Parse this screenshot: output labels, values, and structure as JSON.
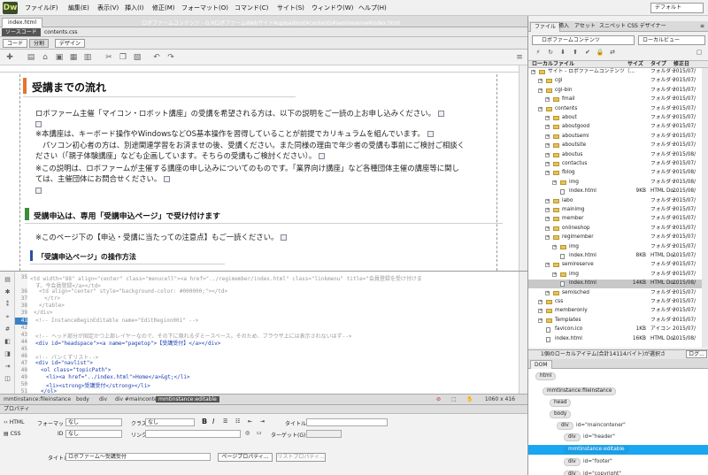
{
  "menubar": {
    "logo": "Dw",
    "items": [
      "ファイル(F)",
      "編集(E)",
      "表示(V)",
      "挿入(I)",
      "修正(M)",
      "フォーマット(O)",
      "コマンド(C)",
      "サイト(S)",
      "ウィンドウ(W)",
      "ヘルプ(H)"
    ],
    "workspace": "デフォルト"
  },
  "document": {
    "tab": "index.html",
    "path": "ロボファームコンテンツ - G:¥ロボファームWebサイト¥uploadroot¥contents¥semireserve¥index.html",
    "source_button": "ソースコード",
    "related_file": "contents.css",
    "views": {
      "code": "コード",
      "split": "分割",
      "design": "デザイン"
    }
  },
  "design": {
    "h1": "受講までの流れ",
    "paragraphs": [
      "ロボファーム主催「マイコン・ロボット講座」の受講を希望される方は、以下の説明をご一読の上お申し込みください。",
      "※本講座は、キーボード操作やWindowsなどOS基本操作を習得していることが前提でカリキュラムを組んでいます。",
      "パソコン初心者の方は、別途関連学習をお済ませの後、受講ください。また同様の理由で年少者の受講も事前にご検討ご相談く",
      "ださい（「親子体験講座」なども企画しています。そちらの受講もご検討ください）。",
      "※この説明は、ロボファームが主催する講座の申し込みについてのものです。「業界向け講座」など各種団体主催の講座等に関し",
      "ては、主催団体にお問合せください。"
    ],
    "h2": "受講申込は、専用「受講申込ページ」で受け付けます",
    "note": "※このページ下の【申込・受講に当たっての注意点】もご一読ください。",
    "h3": "「受講申込ページ」の操作方法"
  },
  "code": {
    "lines": [
      {
        "n": "35",
        "text": "<td width=\"88\" align=\"center\" class=\"menucell\"><a href=\"../regimember/index.html\" class=\"linkmenu\" title=\"会員登録を受け付けま"
      },
      {
        "n": "",
        "text": "す。今会員登録</a></td>"
      },
      {
        "n": "36",
        "text": "<td align=\"center\" style=\"background-color: #000000;\"></td>"
      },
      {
        "n": "37",
        "text": "</tr>"
      },
      {
        "n": "38",
        "text": "</table>"
      },
      {
        "n": "39",
        "text": "</div>"
      },
      {
        "n": "40",
        "text": ""
      },
      {
        "n": "41",
        "text": "<!-- InstanceBeginEditable name=\"EditRegion001\" -->"
      },
      {
        "n": "42",
        "text": ""
      },
      {
        "n": "43",
        "text": "<!-- ヘッド部分が固定かつ上部レイヤーなので、その下に隠れるダミースペース。そのため、ブラウザ上には表示されないはず-->"
      },
      {
        "n": "44",
        "text": "<div id=\"headspace\"><a name=\"pagetop\">【受講受付】</a></div>"
      },
      {
        "n": "45",
        "text": ""
      },
      {
        "n": "46",
        "text": "<!-- パンくずリスト-->"
      },
      {
        "n": "47",
        "text": "<div id=\"navlist\">"
      },
      {
        "n": "48",
        "text": "<ol class=\"topicPath\">"
      },
      {
        "n": "49",
        "text": "<li><a href=\"../index.html\">Home</a>&gt;</li>"
      },
      {
        "n": "50",
        "text": "<li><strong>受講受付</strong></li>"
      },
      {
        "n": "51",
        "text": "</ol>"
      }
    ]
  },
  "statusbar": {
    "tags": [
      "mmtinstance:fileinstance",
      "body",
      "div",
      "div #maincontener",
      "mmtinstance:editable"
    ],
    "dims": "1060 x 416"
  },
  "properties": {
    "title": "プロパティ",
    "html": "HTML",
    "css": "CSS",
    "format_label": "フォーマット",
    "format_value": "なし",
    "class_label": "クラス",
    "class_value": "なし",
    "id_label": "ID",
    "id_value": "なし",
    "link_label": "リンク",
    "title_label": "タイトル",
    "target_label": "ターゲット(G)",
    "doc_title_label": "タイトル",
    "doc_title_value": "ロボファーム～受講受付",
    "page_props": "ページプロパティ...",
    "list_props": "リストプロパティ..."
  },
  "files": {
    "tabs": [
      "ファイル",
      "挿入",
      "アセット",
      "スニペット",
      "CSS デザイナー"
    ],
    "site_select": "ロボファームコンテンツ",
    "view_select": "ローカルビュー",
    "headers": {
      "name": "ローカルファイル",
      "size": "サイズ",
      "type": "タイプ",
      "date": "修正日"
    },
    "rows": [
      {
        "indent": 0,
        "name": "サイト - ロボファームコンテンツ（...",
        "size": "",
        "type": "フォルダー",
        "date": "2015/07/",
        "kind": "folder"
      },
      {
        "indent": 1,
        "name": "cgi",
        "size": "",
        "type": "フォルダー",
        "date": "2015/07/",
        "kind": "folder"
      },
      {
        "indent": 1,
        "name": "cgi-bin",
        "size": "",
        "type": "フォルダー",
        "date": "2015/07/",
        "kind": "folder"
      },
      {
        "indent": 2,
        "name": "fmail",
        "size": "",
        "type": "フォルダー",
        "date": "2015/07/",
        "kind": "folder"
      },
      {
        "indent": 1,
        "name": "contents",
        "size": "",
        "type": "フォルダー",
        "date": "2015/07/",
        "kind": "folder"
      },
      {
        "indent": 2,
        "name": "about",
        "size": "",
        "type": "フォルダー",
        "date": "2015/07/",
        "kind": "folder"
      },
      {
        "indent": 2,
        "name": "aboutgood",
        "size": "",
        "type": "フォルダー",
        "date": "2015/07/",
        "kind": "folder"
      },
      {
        "indent": 2,
        "name": "aboutsemi",
        "size": "",
        "type": "フォルダー",
        "date": "2015/07/",
        "kind": "folder"
      },
      {
        "indent": 2,
        "name": "aboutsite",
        "size": "",
        "type": "フォルダー",
        "date": "2015/07/",
        "kind": "folder"
      },
      {
        "indent": 2,
        "name": "aboutus",
        "size": "",
        "type": "フォルダー",
        "date": "2015/08/",
        "kind": "folder"
      },
      {
        "indent": 2,
        "name": "contactus",
        "size": "",
        "type": "フォルダー",
        "date": "2015/07/",
        "kind": "folder"
      },
      {
        "indent": 2,
        "name": "fblog",
        "size": "",
        "type": "フォルダー",
        "date": "2015/08/",
        "kind": "folder"
      },
      {
        "indent": 3,
        "name": "img",
        "size": "",
        "type": "フォルダー",
        "date": "2015/08/",
        "kind": "folder"
      },
      {
        "indent": 3,
        "name": "index.html",
        "size": "9KB",
        "type": "HTML Do...",
        "date": "2015/08/",
        "kind": "file"
      },
      {
        "indent": 2,
        "name": "labo",
        "size": "",
        "type": "フォルダー",
        "date": "2015/07/",
        "kind": "folder"
      },
      {
        "indent": 2,
        "name": "mainimg",
        "size": "",
        "type": "フォルダー",
        "date": "2015/07/",
        "kind": "folder"
      },
      {
        "indent": 2,
        "name": "member",
        "size": "",
        "type": "フォルダー",
        "date": "2015/07/",
        "kind": "folder"
      },
      {
        "indent": 2,
        "name": "onlineshop",
        "size": "",
        "type": "フォルダー",
        "date": "2015/07/",
        "kind": "folder"
      },
      {
        "indent": 2,
        "name": "regimember",
        "size": "",
        "type": "フォルダー",
        "date": "2015/07/",
        "kind": "folder"
      },
      {
        "indent": 3,
        "name": "img",
        "size": "",
        "type": "フォルダー",
        "date": "2015/07/",
        "kind": "folder"
      },
      {
        "indent": 3,
        "name": "index.html",
        "size": "8KB",
        "type": "HTML Do...",
        "date": "2015/07/",
        "kind": "file"
      },
      {
        "indent": 2,
        "name": "semireserve",
        "size": "",
        "type": "フォルダー",
        "date": "2015/07/",
        "kind": "folder"
      },
      {
        "indent": 3,
        "name": "img",
        "size": "",
        "type": "フォルダー",
        "date": "2015/07/",
        "kind": "folder"
      },
      {
        "indent": 3,
        "name": "index.html",
        "size": "14KB",
        "type": "HTML Do...",
        "date": "2015/08/",
        "kind": "file",
        "selected": true
      },
      {
        "indent": 2,
        "name": "semisched",
        "size": "",
        "type": "フォルダー",
        "date": "2015/07/",
        "kind": "folder"
      },
      {
        "indent": 1,
        "name": "css",
        "size": "",
        "type": "フォルダー",
        "date": "2015/07/",
        "kind": "folder"
      },
      {
        "indent": 1,
        "name": "memberonly",
        "size": "",
        "type": "フォルダー",
        "date": "2015/07/",
        "kind": "folder"
      },
      {
        "indent": 1,
        "name": "Templates",
        "size": "",
        "type": "フォルダー",
        "date": "2015/07/",
        "kind": "folder"
      },
      {
        "indent": 1,
        "name": "favicon.ico",
        "size": "1KB",
        "type": "アイコン",
        "date": "2015/07/",
        "kind": "file"
      },
      {
        "indent": 1,
        "name": "index.html",
        "size": "16KB",
        "type": "HTML Do...",
        "date": "2015/08/",
        "kind": "file"
      }
    ],
    "status": "1個のローカルアイテム(合計14114バイト)が選択さ",
    "log_button": "ログ..."
  },
  "dom": {
    "tab": "DOM",
    "nodes": [
      {
        "tag": "html",
        "attr": "",
        "indent": 0
      },
      {
        "tag": "mmtinstance:fileinstance",
        "attr": "",
        "indent": 1
      },
      {
        "tag": "head",
        "attr": "",
        "indent": 2
      },
      {
        "tag": "body",
        "attr": "",
        "indent": 2
      },
      {
        "tag": "div",
        "attr": "id=\"maincontener\"",
        "indent": 3
      },
      {
        "tag": "div",
        "attr": "id=\"header\"",
        "indent": 4
      },
      {
        "tag": "mmtinstance:editable",
        "attr": "",
        "indent": 4,
        "selected": true
      },
      {
        "tag": "div",
        "attr": "id=\"footer\"",
        "indent": 4
      },
      {
        "tag": "div",
        "attr": "id=\"copyright\"",
        "indent": 4
      }
    ]
  }
}
